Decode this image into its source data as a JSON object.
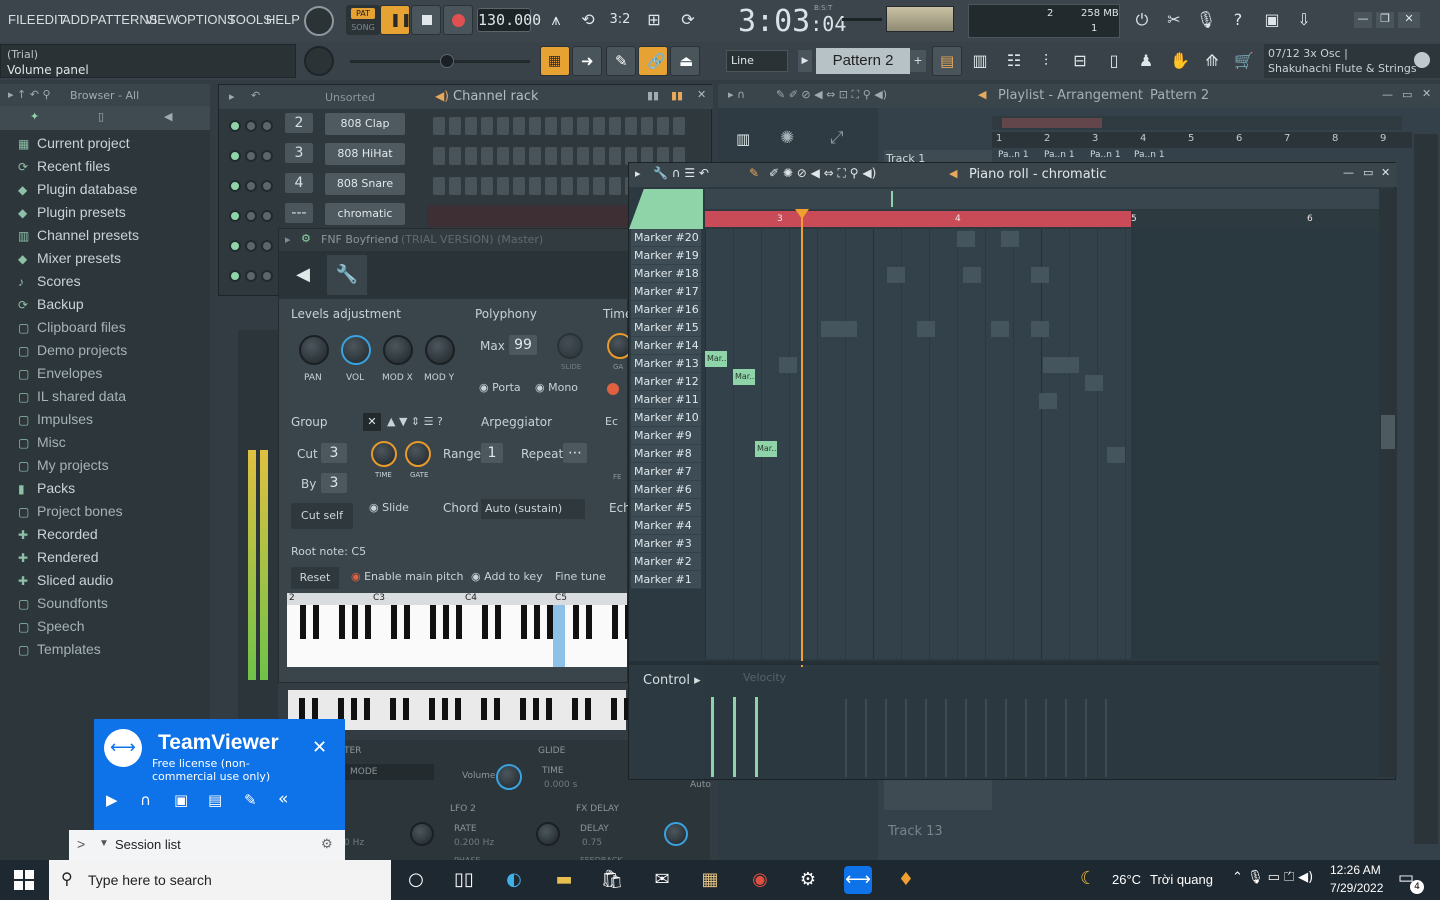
{
  "menu": [
    "FILE",
    "EDIT",
    "ADD",
    "PATTERNS",
    "VIEW",
    "OPTIONS",
    "TOOLS",
    "HELP"
  ],
  "transport": {
    "pat_label": "PAT",
    "song_label": "SONG",
    "tempo": "130.000",
    "time": "3:03",
    "time_sub": "04",
    "bst": "B:S:T"
  },
  "memory": {
    "cpu": "2",
    "mem": "258 MB",
    "poly": "1"
  },
  "hint": {
    "line1": "(Trial)",
    "line2": "Volume panel"
  },
  "snap": "Line",
  "pattern": "Pattern 2",
  "plugin_info": {
    "line1": "07/12  3x Osc |",
    "line2": "Shakuhachi Flute & Strings"
  },
  "browser": {
    "title": "Browser - All",
    "items": [
      {
        "label": "Current project",
        "icon": "project-icon"
      },
      {
        "label": "Recent files",
        "icon": "recent-icon"
      },
      {
        "label": "Plugin database",
        "icon": "plug-icon"
      },
      {
        "label": "Plugin presets",
        "icon": "plug-icon"
      },
      {
        "label": "Channel presets",
        "icon": "channel-icon"
      },
      {
        "label": "Mixer presets",
        "icon": "mixer-icon"
      },
      {
        "label": "Scores",
        "icon": "note-icon"
      },
      {
        "label": "Backup",
        "icon": "backup-icon"
      },
      {
        "label": "Clipboard files",
        "icon": "folder-icon"
      },
      {
        "label": "Demo projects",
        "icon": "folder-icon"
      },
      {
        "label": "Envelopes",
        "icon": "folder-icon"
      },
      {
        "label": "IL shared data",
        "icon": "folder-icon"
      },
      {
        "label": "Impulses",
        "icon": "folder-icon"
      },
      {
        "label": "Misc",
        "icon": "folder-icon"
      },
      {
        "label": "My projects",
        "icon": "folder-icon"
      },
      {
        "label": "Packs",
        "icon": "packs-icon"
      },
      {
        "label": "Project bones",
        "icon": "folder-icon"
      },
      {
        "label": "Recorded",
        "icon": "recorded-icon"
      },
      {
        "label": "Rendered",
        "icon": "rendered-icon"
      },
      {
        "label": "Sliced audio",
        "icon": "sliced-icon"
      },
      {
        "label": "Soundfonts",
        "icon": "folder-icon"
      },
      {
        "label": "Speech",
        "icon": "folder-icon"
      },
      {
        "label": "Templates",
        "icon": "folder-icon"
      }
    ]
  },
  "channel_rack": {
    "title": "Channel rack",
    "filter": "Unsorted",
    "channels": [
      {
        "num": "2",
        "name": "808 Clap"
      },
      {
        "num": "3",
        "name": "808 HiHat"
      },
      {
        "num": "4",
        "name": "808 Snare"
      },
      {
        "num": "---",
        "name": "chromatic"
      }
    ]
  },
  "channel_settings": {
    "title": "FNF Boyfriend",
    "trial": "(TRIAL VERSION) (Master)",
    "levels_title": "Levels adjustment",
    "levels_knobs": [
      "PAN",
      "VOL",
      "MOD X",
      "MOD Y"
    ],
    "poly_title": "Polyphony",
    "max_label": "Max",
    "max_value": "99",
    "slide_small": "SLIDE",
    "porta": "Porta",
    "mono": "Mono",
    "time_title": "Time",
    "group_title": "Group",
    "cut_label": "Cut",
    "cut_value": "3",
    "by_label": "By",
    "by_value": "3",
    "cut_self": "Cut self",
    "arp_title": "Arpeggiator",
    "arp_knobs": [
      "TIME",
      "GATE"
    ],
    "range_label": "Range",
    "range_value": "1",
    "repeat_label": "Repeat",
    "slide": "Slide",
    "chord_label": "Chord",
    "chord_value": "Auto (sustain)",
    "root_note": "Root note: C5",
    "reset": "Reset",
    "enable_pitch": "Enable main pitch",
    "add_to_key": "Add to key",
    "fine_tune": "Fine tune",
    "octaves": [
      "2",
      "C3",
      "C4",
      "C5"
    ],
    "edge_ec": "Ec",
    "edge_ech": "Ech",
    "edge_fe": "FE",
    "edge_ga": "GA"
  },
  "lower_panels": {
    "filter_mode": "MODE",
    "volume": "Volume",
    "glide": "GLIDE",
    "glide_time": "TIME",
    "glide_val": "0.000 s",
    "auto": "Auto",
    "lfo2": "LFO 2",
    "rate": "RATE",
    "rate_val": "0.200 Hz",
    "hz": "0 Hz",
    "phase": "PHASE",
    "fx_delay": "FX DELAY",
    "delay": "DELAY",
    "delay_val": "0.75",
    "feedback": "FEEDBACK",
    "ter": "TER"
  },
  "playlist": {
    "title": "Playlist - Arrangement",
    "pattern": "Pattern 2",
    "ruler": [
      "1",
      "2",
      "3",
      "4",
      "5",
      "6",
      "7",
      "8",
      "9"
    ],
    "track1": "Track 1",
    "track13": "Track 13",
    "clip_label": "Pa..n 1"
  },
  "piano_roll": {
    "title": "Piano roll - chromatic",
    "ruler": [
      "3",
      "4",
      "5",
      "6"
    ],
    "markers": [
      "Marker #20",
      "Marker #19",
      "Marker #18",
      "Marker #17",
      "Marker #16",
      "Marker #15",
      "Marker #14",
      "Marker #13",
      "Marker #12",
      "Marker #11",
      "Marker #10",
      "Marker #9",
      "Marker #8",
      "Marker #7",
      "Marker #6",
      "Marker #5",
      "Marker #4",
      "Marker #3",
      "Marker #2",
      "Marker #1"
    ],
    "note_label": "Mar..",
    "control": "Control",
    "velocity": "Velocity"
  },
  "teamviewer": {
    "title": "TeamViewer",
    "license": "Free license (non-commercial use only)",
    "session_list": "Session list"
  },
  "taskbar": {
    "search": "Type here to search",
    "weather_temp": "26°C",
    "weather_text": "Trời quang",
    "clock_time": "12:26 AM",
    "clock_date": "7/29/2022",
    "notif": "4"
  },
  "colors": {
    "accent_orange": "#f0a030",
    "marker_green": "#8fd4a8",
    "piano_red": "#c94b58",
    "tv_blue": "#0e72e8"
  }
}
